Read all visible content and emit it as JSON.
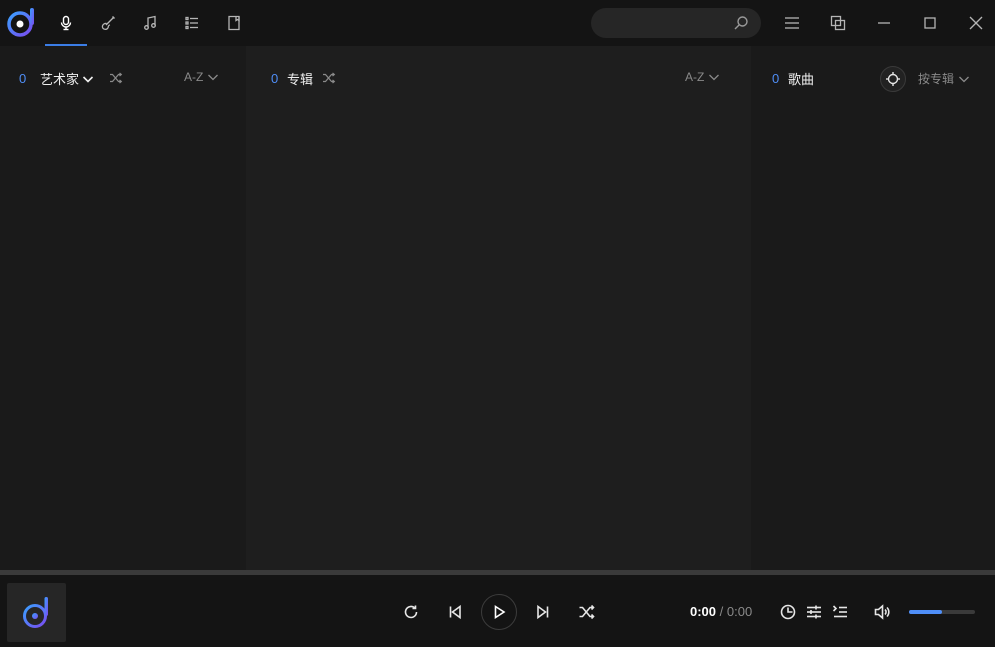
{
  "colors": {
    "accent": "#3b7de6",
    "count_blue": "#4f8ef7",
    "icon": "#c8c8c8"
  },
  "topbar": {
    "nav_tabs": [
      {
        "icon": "microphone-icon",
        "active": true
      },
      {
        "icon": "guitar-icon",
        "active": false
      },
      {
        "icon": "music-note-icon",
        "active": false
      },
      {
        "icon": "list-icon",
        "active": false
      },
      {
        "icon": "document-icon",
        "active": false
      }
    ],
    "search": {
      "value": "",
      "placeholder": ""
    },
    "window_buttons": [
      "menu-icon",
      "mini-mode-icon",
      "minimize-icon",
      "maximize-icon",
      "close-icon"
    ]
  },
  "panels": {
    "artists": {
      "count": "0",
      "title": "艺术家",
      "sort": "A-Z"
    },
    "albums": {
      "count": "0",
      "title": "专辑",
      "sort": "A-Z"
    },
    "songs": {
      "count": "0",
      "title": "歌曲",
      "sort": "按专辑"
    }
  },
  "progress": {
    "fraction": 0
  },
  "player": {
    "time_current": "0:00",
    "time_separator": "/",
    "time_total": "0:00",
    "volume": 0.5
  }
}
